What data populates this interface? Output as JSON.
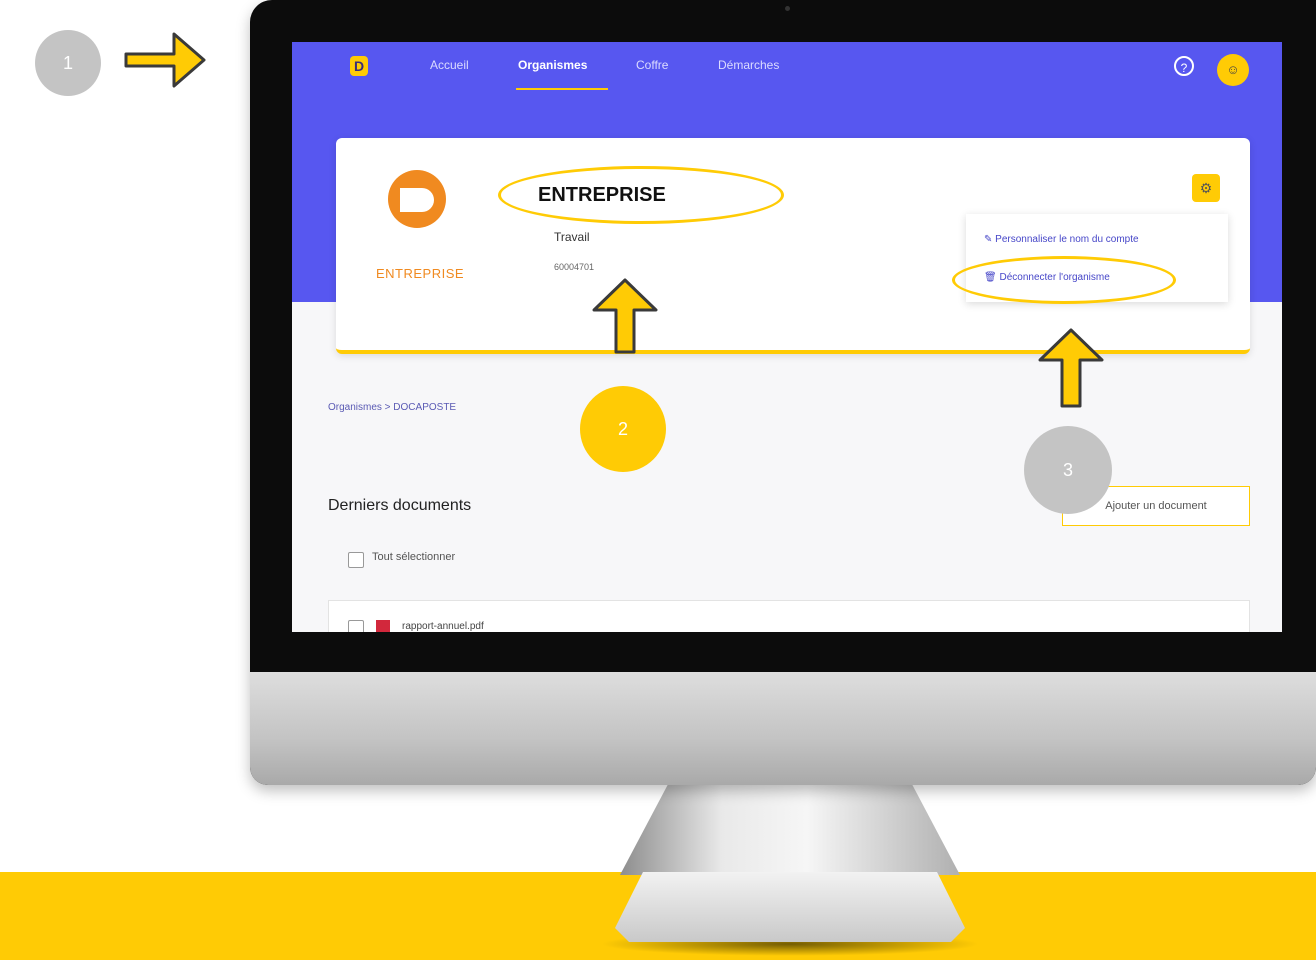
{
  "nav": {
    "logo": "D",
    "items": [
      "Accueil",
      "Organismes",
      "Coffre",
      "Démarches"
    ],
    "help": "?",
    "avatar": "☺"
  },
  "card": {
    "logo_text": "ENTREPRISE",
    "name": "Travail",
    "id": "60004701",
    "menu": [
      "Personnaliser le nom du compte",
      "Déconnecter l'organisme"
    ],
    "menu_icons": [
      "✎",
      "🗑"
    ]
  },
  "breadcrumb": "Organismes > DOCAPOSTE",
  "documents": {
    "title": "Derniers documents",
    "select_all": "Tout sélectionner",
    "add_button": "Ajouter un document",
    "rows": [
      {
        "file": "rapport-annuel.pdf"
      }
    ]
  },
  "annotations": {
    "steps": [
      "1",
      "2",
      "3"
    ],
    "entreprise_label": "ENTREPRISE"
  },
  "colors": {
    "hero": "#5757f0",
    "accent": "#ffcb05",
    "brand_orange": "#f08a20"
  }
}
